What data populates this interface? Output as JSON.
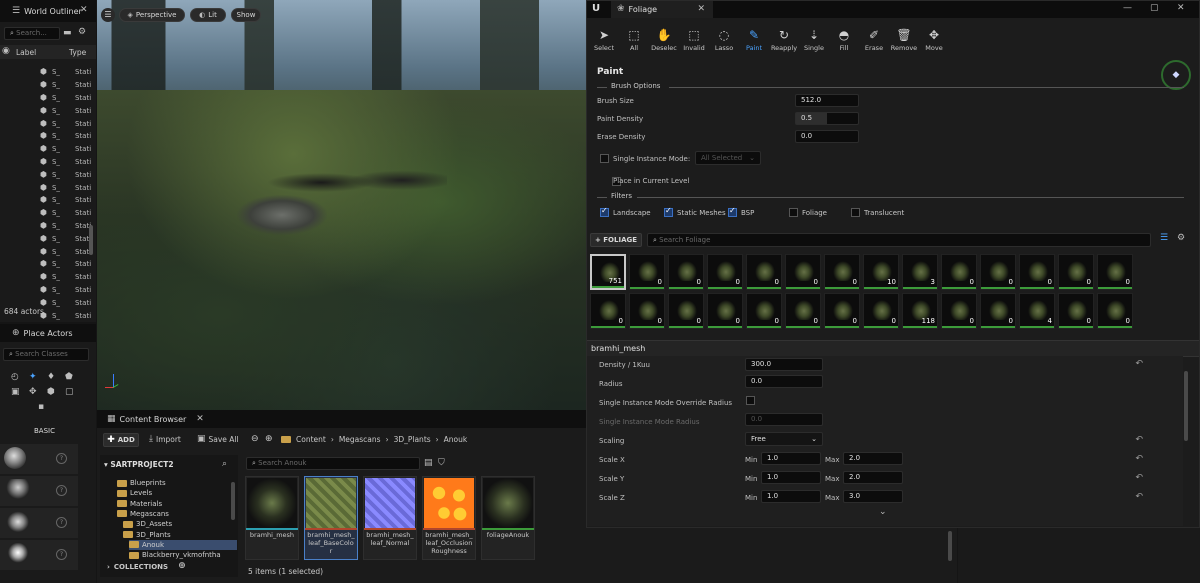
{
  "outliner": {
    "tab_title": "World Outliner",
    "search_placeholder": "Search...",
    "col_label": "Label",
    "col_type": "Type",
    "rows": [
      {
        "label": "S_",
        "type": "Stati"
      },
      {
        "label": "S_",
        "type": "Stati"
      },
      {
        "label": "S_",
        "type": "Stati"
      },
      {
        "label": "S_",
        "type": "Stati"
      },
      {
        "label": "S_",
        "type": "Stati"
      },
      {
        "label": "S_",
        "type": "Stati"
      },
      {
        "label": "S_",
        "type": "Stati"
      },
      {
        "label": "S_",
        "type": "Stati"
      },
      {
        "label": "S_",
        "type": "Stati"
      },
      {
        "label": "S_",
        "type": "Stati"
      },
      {
        "label": "S_",
        "type": "Stati"
      },
      {
        "label": "S_",
        "type": "Stati"
      },
      {
        "label": "S_",
        "type": "Stati"
      },
      {
        "label": "S_",
        "type": "Stati"
      },
      {
        "label": "S_",
        "type": "Stati"
      },
      {
        "label": "S_",
        "type": "Stati"
      },
      {
        "label": "S_",
        "type": "Stati"
      },
      {
        "label": "S_",
        "type": "Stati"
      },
      {
        "label": "S_",
        "type": "Stati"
      },
      {
        "label": "S_",
        "type": "Stati"
      }
    ],
    "actor_count": "684 actors"
  },
  "place_actors": {
    "tab_title": "Place Actors",
    "search_placeholder": "Search Classes",
    "category": "BASIC"
  },
  "viewport": {
    "perspective": "Perspective",
    "lit": "Lit",
    "show": "Show"
  },
  "foliage": {
    "tab_title": "Foliage",
    "tools": [
      {
        "label": "Select",
        "icon": "cursor-icon"
      },
      {
        "label": "All",
        "icon": "select-all-icon"
      },
      {
        "label": "Deselec",
        "icon": "deselect-icon"
      },
      {
        "label": "Invalid",
        "icon": "invalid-icon"
      },
      {
        "label": "Lasso",
        "icon": "lasso-icon"
      },
      {
        "label": "Paint",
        "icon": "paint-brush-icon",
        "active": true
      },
      {
        "label": "Reapply",
        "icon": "reapply-icon"
      },
      {
        "label": "Single",
        "icon": "single-icon"
      },
      {
        "label": "Fill",
        "icon": "fill-icon"
      },
      {
        "label": "Erase",
        "icon": "erase-icon"
      },
      {
        "label": "Remove",
        "icon": "remove-icon"
      },
      {
        "label": "Move",
        "icon": "move-icon"
      }
    ],
    "section_title": "Paint",
    "brush_options_title": "Brush Options",
    "brush_size_label": "Brush Size",
    "brush_size_value": "512.0",
    "paint_density_label": "Paint Density",
    "paint_density_value": "0.5",
    "erase_density_label": "Erase Density",
    "erase_density_value": "0.0",
    "single_instance_label": "Single Instance Mode:",
    "single_instance_value": "All Selected",
    "place_current_level_label": "Place in Current Level",
    "filters_title": "Filters",
    "filters": [
      {
        "label": "Landscape",
        "checked": true
      },
      {
        "label": "Static Meshes",
        "checked": true
      },
      {
        "label": "BSP",
        "checked": true
      },
      {
        "label": "Foliage",
        "checked": false
      },
      {
        "label": "Translucent",
        "checked": false
      }
    ],
    "add_foliage_label": "+ FOLIAGE",
    "search_placeholder": "Search Foliage",
    "grid_row1": [
      "751",
      "0",
      "0",
      "0",
      "0",
      "0",
      "0",
      "10",
      "3",
      "0",
      "0",
      "0",
      "0",
      "0"
    ],
    "grid_row2": [
      "0",
      "0",
      "0",
      "0",
      "0",
      "0",
      "0",
      "0",
      "118",
      "0",
      "0",
      "4",
      "0",
      "0"
    ],
    "selected_mesh": "bramhi_mesh",
    "density_label": "Density / 1Kuu",
    "density_value": "300.0",
    "radius_label": "Radius",
    "radius_value": "0.0",
    "override_radius_label": "Single Instance Mode Override Radius",
    "sim_radius_label": "Single Instance Mode Radius",
    "sim_radius_value": "0.0",
    "scaling_label": "Scaling",
    "scaling_value": "Free",
    "scale_x_label": "Scale X",
    "scale_y_label": "Scale Y",
    "scale_z_label": "Scale Z",
    "min_label": "Min",
    "max_label": "Max",
    "scale_x_min": "1.0",
    "scale_x_max": "2.0",
    "scale_y_min": "1.0",
    "scale_y_max": "2.0",
    "scale_z_min": "1.0",
    "scale_z_max": "3.0"
  },
  "content_browser": {
    "tab_title": "Content Browser",
    "add_label": "ADD",
    "import_label": "Import",
    "save_all_label": "Save All",
    "breadcrumb": [
      "Content",
      "Megascans",
      "3D_Plants",
      "Anouk"
    ],
    "project_label": "SARTPROJECT2",
    "search_placeholder": "Search Anouk",
    "folders": [
      {
        "name": "Blueprints",
        "indent": 1
      },
      {
        "name": "Levels",
        "indent": 1
      },
      {
        "name": "Materials",
        "indent": 1
      },
      {
        "name": "Megascans",
        "indent": 1
      },
      {
        "name": "3D_Assets",
        "indent": 2
      },
      {
        "name": "3D_Plants",
        "indent": 2
      },
      {
        "name": "Anouk",
        "indent": 3
      },
      {
        "name": "Blackberry_vkmofntha",
        "indent": 3
      }
    ],
    "collections_label": "COLLECTIONS",
    "assets": [
      {
        "name": "bramhi_mesh",
        "color": "#2c9fb0"
      },
      {
        "name": "bramhi_mesh_leaf_BaseColor",
        "color": "#b0452c"
      },
      {
        "name": "bramhi_mesh_leaf_Normal",
        "color": "#b0452c"
      },
      {
        "name": "bramhi_mesh_leaf_Occlusion Roughness",
        "color": "#b0452c"
      },
      {
        "name": "foliageAnouk",
        "color": "#3c9b3a"
      }
    ],
    "status": "5 items (1 selected)"
  }
}
